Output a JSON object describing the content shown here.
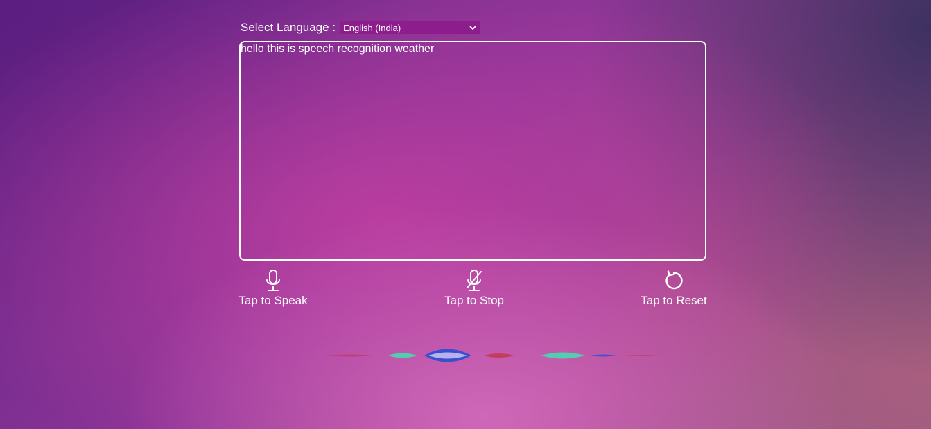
{
  "language": {
    "label": "Select Language :",
    "selected": "English (India)"
  },
  "transcript": {
    "text": "hello this is speech recognition weather"
  },
  "controls": {
    "speak": {
      "label": "Tap to Speak",
      "icon": "microphone-icon"
    },
    "stop": {
      "label": "Tap to Stop",
      "icon": "microphone-off-icon"
    },
    "reset": {
      "label": "Tap to Reset",
      "icon": "reset-icon"
    }
  },
  "colors": {
    "select_bg": "#8d1d8c",
    "wave_teal": "#3fe0b0",
    "wave_blue": "#2a4fd0",
    "wave_red": "#c03a50"
  }
}
